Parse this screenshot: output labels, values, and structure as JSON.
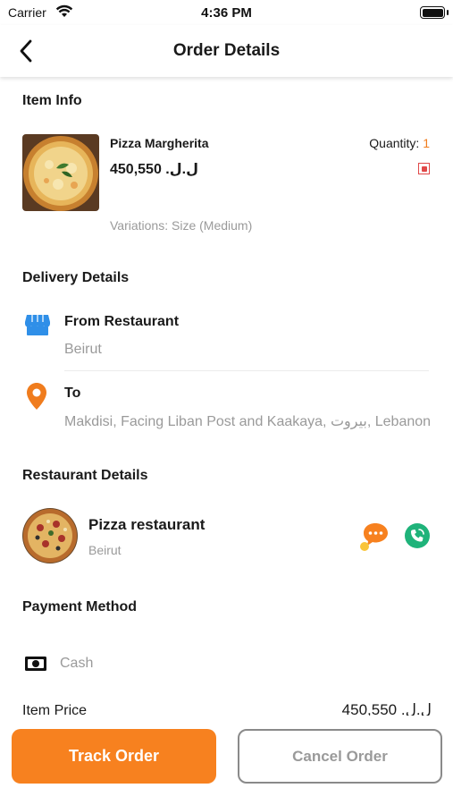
{
  "status_bar": {
    "carrier": "Carrier",
    "time": "4:36 PM"
  },
  "nav": {
    "title": "Order Details"
  },
  "item_info": {
    "section_title": "Item Info",
    "name": "Pizza Margherita",
    "price": "450,550 .ل.ل",
    "quantity_label": "Quantity: ",
    "quantity_value": "1",
    "variations": "Variations: Size (Medium)"
  },
  "delivery": {
    "section_title": "Delivery Details",
    "from_label": "From Restaurant",
    "from_address": "Beirut",
    "to_label": "To",
    "to_address": "Makdisi, Facing Liban Post and Kaakaya, بيروت, Lebanon"
  },
  "restaurant": {
    "section_title": "Restaurant Details",
    "name": "Pizza restaurant",
    "address": "Beirut"
  },
  "payment": {
    "section_title": "Payment Method",
    "method": "Cash"
  },
  "summary": {
    "item_price_label": "Item Price",
    "item_price_value": "450,550 .ل.ل"
  },
  "actions": {
    "track_label": "Track Order",
    "cancel_label": "Cancel Order"
  },
  "colors": {
    "accent": "#f7811f",
    "store_icon": "#2f8fe8",
    "call_icon": "#1fb37a",
    "veg_mark": "#e04848",
    "muted_text": "#9a9a9a"
  },
  "icons": {
    "back": "chevron-left-icon",
    "store": "store-icon",
    "location": "location-pin-icon",
    "chat": "chat-bubble-icon",
    "call": "phone-call-icon",
    "cash": "cash-icon",
    "wifi": "wifi-icon",
    "battery": "battery-icon"
  }
}
